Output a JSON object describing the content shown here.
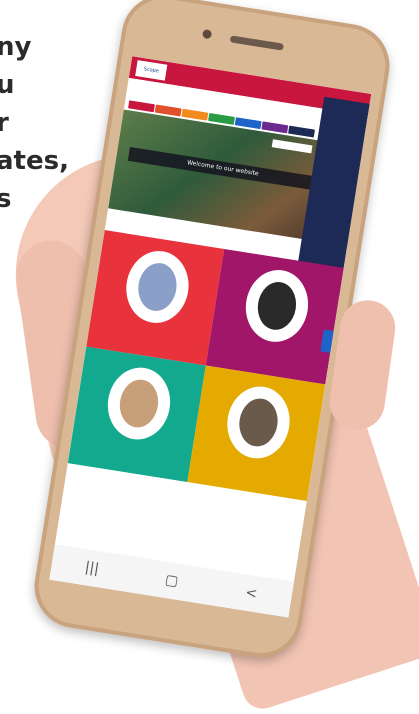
{
  "background_text": {
    "lines": [
      "ny",
      "u",
      "r",
      "ates,",
      "s"
    ]
  },
  "site": {
    "top_logo": "Scope",
    "brand": "",
    "nav_colors": [
      "#c8163e",
      "#e0502a",
      "#f28a1c",
      "#2b9a45",
      "#1e64c8",
      "#6a2a8e",
      "#1d2a55"
    ],
    "hero_banner": "Welcome to our website",
    "tagline": "",
    "tiles": [
      {
        "title": "",
        "subtitle": "",
        "color": "#e8333d",
        "inner": "#8aa0c8"
      },
      {
        "title": "",
        "subtitle": "",
        "color": "#a2166a",
        "inner": "#2a2a2a"
      },
      {
        "title": "",
        "subtitle": "",
        "color": "#12a98e",
        "inner": "#c7a07a"
      },
      {
        "title": "",
        "subtitle": "",
        "color": "#e5aa00",
        "inner": "#6a5a4a"
      }
    ]
  },
  "android_nav": {
    "recent": "|||",
    "home": "▢",
    "back": "<"
  }
}
